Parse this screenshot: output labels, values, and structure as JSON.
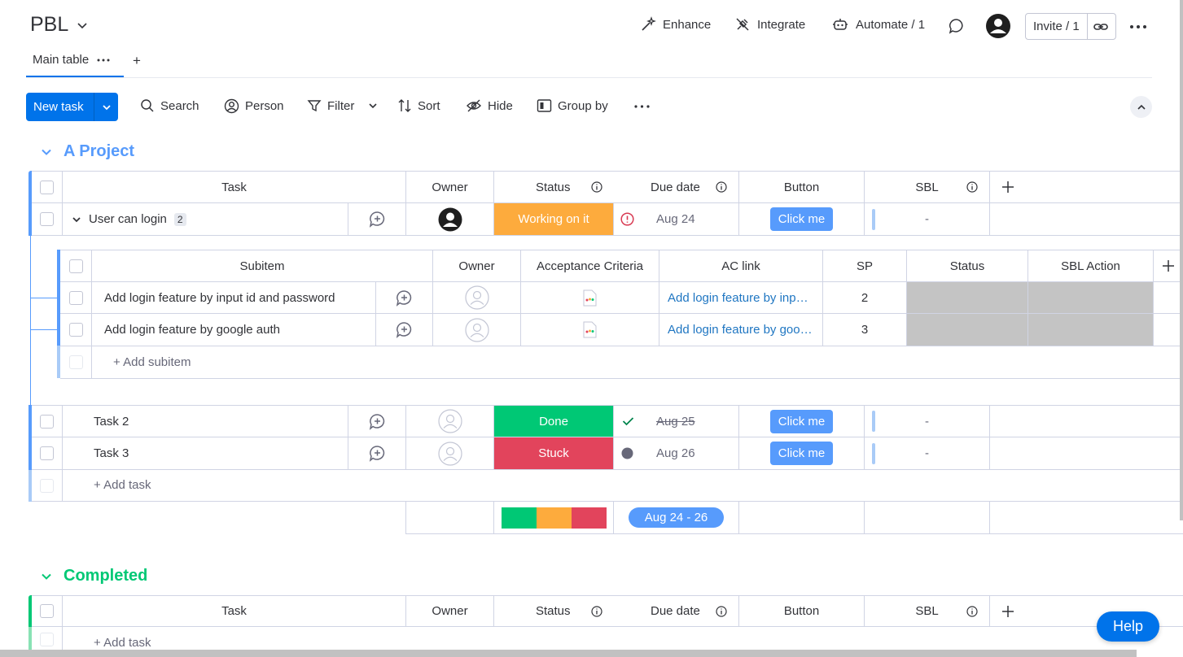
{
  "header": {
    "title": "PBL",
    "enhance": "Enhance",
    "integrate": "Integrate",
    "automate": "Automate / 1",
    "invite": "Invite / 1"
  },
  "tabs": {
    "main": "Main table",
    "add": "+"
  },
  "toolbar": {
    "new_task": "New task",
    "search": "Search",
    "person": "Person",
    "filter": "Filter",
    "sort": "Sort",
    "hide": "Hide",
    "group_by": "Group by"
  },
  "groups": [
    {
      "title": "A Project",
      "color": "#579bfc",
      "columns": {
        "task": "Task",
        "owner": "Owner",
        "status": "Status",
        "due": "Due date",
        "button": "Button",
        "sbl": "SBL"
      },
      "rows": [
        {
          "task": "User can login",
          "sub_count": "2",
          "status": "Working on it",
          "status_color": "#fdab3d",
          "due": "Aug 24",
          "button": "Click me",
          "sbl": "-"
        },
        {
          "task": "Task 2",
          "status": "Done",
          "status_color": "#00c875",
          "due": "Aug 25",
          "button": "Click me",
          "sbl": "-"
        },
        {
          "task": "Task 3",
          "status": "Stuck",
          "status_color": "#e2445c",
          "due": "Aug 26",
          "button": "Click me",
          "sbl": "-"
        }
      ],
      "subitems": {
        "columns": {
          "subitem": "Subitem",
          "owner": "Owner",
          "ac": "Acceptance Criteria",
          "ac_link": "AC link",
          "sp": "SP",
          "status": "Status",
          "sbl_action": "SBL Action"
        },
        "rows": [
          {
            "name": "Add login feature by input id and password",
            "link": "Add login feature by input id and password",
            "sp": "2"
          },
          {
            "name": "Add login feature by google auth",
            "link": "Add login feature by google auth",
            "sp": "3"
          }
        ],
        "add": "+ Add subitem"
      },
      "add_task": "+ Add task",
      "summary": {
        "date_range": "Aug 24 - 26",
        "status_colors": [
          "#00c875",
          "#fdab3d",
          "#e2445c"
        ]
      }
    },
    {
      "title": "Completed",
      "color": "#00c875",
      "columns": {
        "task": "Task",
        "owner": "Owner",
        "status": "Status",
        "due": "Due date",
        "button": "Button",
        "sbl": "SBL"
      },
      "add_task": "+ Add task"
    }
  ],
  "help": "Help"
}
